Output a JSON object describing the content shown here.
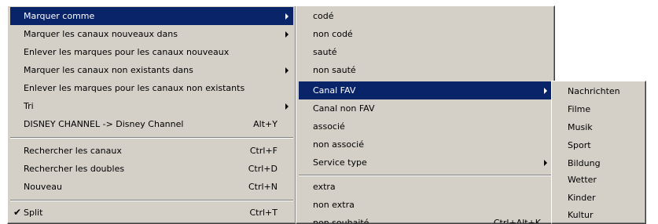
{
  "menu_main": {
    "items": [
      {
        "label": "Marquer comme",
        "shortcut": "",
        "submenu": true,
        "selected": true
      },
      {
        "label": "Marquer les canaux nouveaux dans",
        "shortcut": "",
        "submenu": true
      },
      {
        "label": "Enlever les marques pour les canaux nouveaux",
        "shortcut": ""
      },
      {
        "label": "Marquer les canaux non existants dans",
        "shortcut": "",
        "submenu": true
      },
      {
        "label": "Enlever les marques pour les canaux non existants",
        "shortcut": ""
      },
      {
        "label": "Tri",
        "shortcut": "",
        "submenu": true
      },
      {
        "label": "DISNEY CHANNEL -> Disney Channel",
        "shortcut": "Alt+Y"
      },
      {
        "label": "Rechercher les canaux",
        "shortcut": "Ctrl+F"
      },
      {
        "label": "Rechercher les doubles",
        "shortcut": "Ctrl+D"
      },
      {
        "label": "Nouveau",
        "shortcut": "Ctrl+N"
      },
      {
        "label": "Split",
        "shortcut": "Ctrl+T",
        "checked": true,
        "check_glyph": "✔"
      }
    ]
  },
  "menu_mark_as": {
    "items": [
      {
        "label": "codé"
      },
      {
        "label": "non codé"
      },
      {
        "label": "sauté"
      },
      {
        "label": "non sauté"
      },
      {
        "label": "Canal FAV",
        "submenu": true,
        "selected": true
      },
      {
        "label": "Canal non FAV"
      },
      {
        "label": "associé"
      },
      {
        "label": "non associé"
      },
      {
        "label": "Service type",
        "submenu": true
      },
      {
        "label": "extra"
      },
      {
        "label": "non extra"
      },
      {
        "label": "non souhaité",
        "shortcut": "Ctrl+Alt+K"
      }
    ]
  },
  "menu_fav": {
    "items": [
      {
        "label": "Nachrichten"
      },
      {
        "label": "Filme"
      },
      {
        "label": "Musik"
      },
      {
        "label": "Sport"
      },
      {
        "label": "Bildung"
      },
      {
        "label": "Wetter"
      },
      {
        "label": "Kinder"
      },
      {
        "label": "Kultur"
      }
    ]
  },
  "colors": {
    "menu_bg": "#d4d0c8",
    "highlight_bg": "#0a246a",
    "highlight_text": "#ffffff"
  }
}
